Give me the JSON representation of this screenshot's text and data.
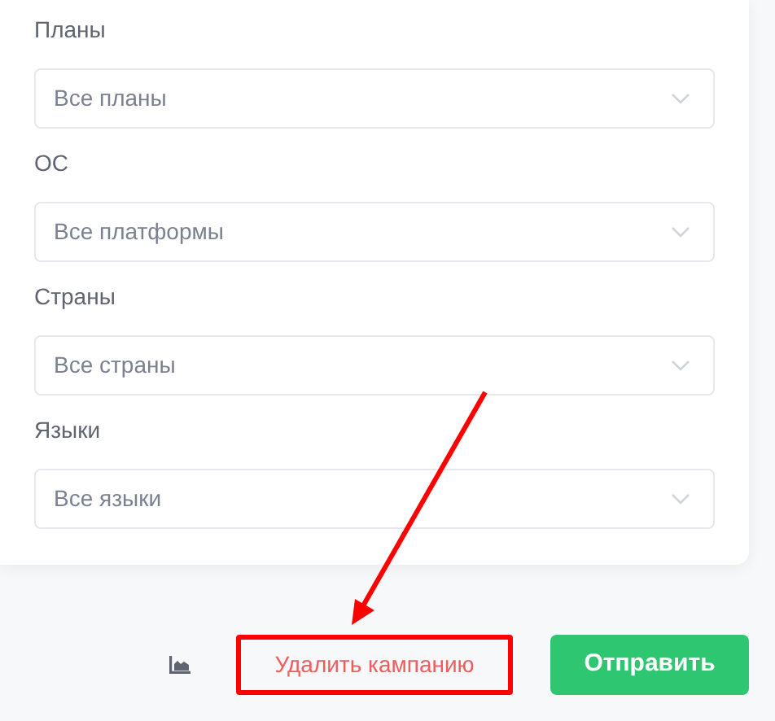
{
  "filters": [
    {
      "label": "Планы",
      "placeholder": "Все планы"
    },
    {
      "label": "ОС",
      "placeholder": "Все платформы"
    },
    {
      "label": "Страны",
      "placeholder": "Все страны"
    },
    {
      "label": "Языки",
      "placeholder": "Все языки"
    }
  ],
  "delete_button": {
    "label": "Удалить кампанию",
    "highlighted": true
  },
  "submit_button": {
    "label": "Отправить"
  }
}
